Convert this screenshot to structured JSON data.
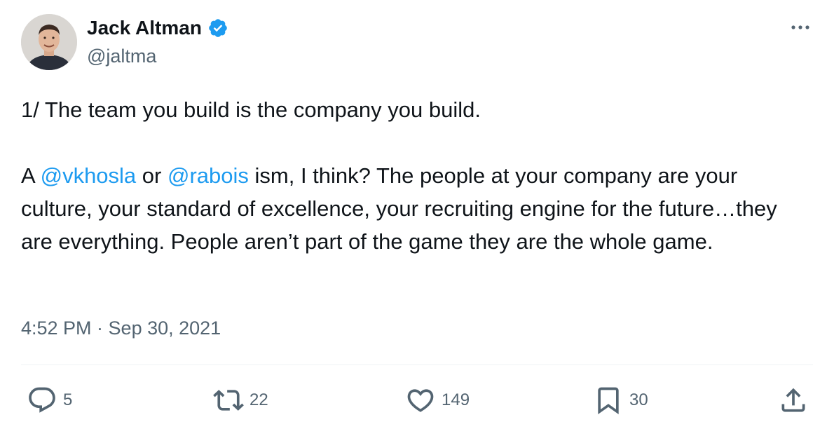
{
  "author": {
    "name": "Jack Altman",
    "handle": "@jaltma",
    "verified": true,
    "avatar_icon": "profile-photo"
  },
  "tweet": {
    "line1": "1/ The team you build is the company you build.",
    "p2_prefix": "A ",
    "mention1": "@vkhosla",
    "p2_or": " or ",
    "mention2": "@rabois",
    "p2_rest": " ism, I think? The people at your company are your culture, your standard of excellence, your recruiting engine for the future…they are everything. People aren’t part of the game they are the whole game.",
    "timestamp": "4:52 PM · Sep 30, 2021"
  },
  "actions": {
    "reply_count": "5",
    "retweet_count": "22",
    "like_count": "149",
    "bookmark_count": "30"
  },
  "icons": {
    "reply": "speech-bubble-icon",
    "retweet": "retweet-arrows-icon",
    "like": "heart-icon",
    "bookmark": "bookmark-icon",
    "share": "share-upload-icon",
    "more": "more-dots-icon",
    "verified": "verified-badge-icon"
  },
  "colors": {
    "accent": "#1d9bf0",
    "text": "#0f1419",
    "secondary": "#536471",
    "divider": "#eff3f4"
  }
}
